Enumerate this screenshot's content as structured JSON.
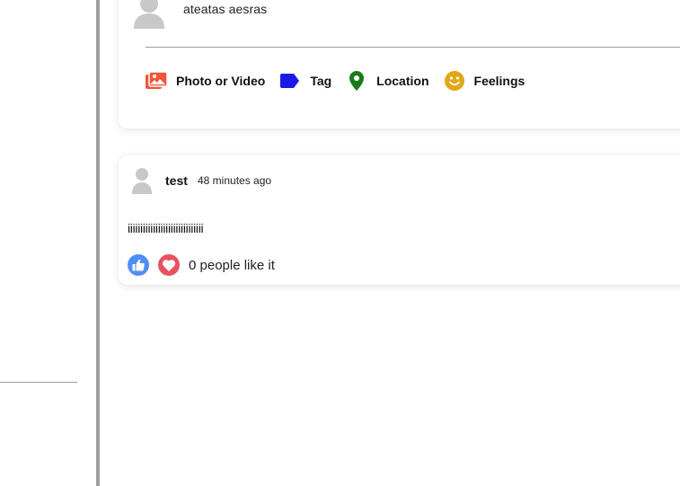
{
  "composer": {
    "user_name": "ateatas aesras",
    "actions": [
      {
        "label": "Photo or Video",
        "icon": "photo-video-icon",
        "color": "#f0563a"
      },
      {
        "label": "Tag",
        "icon": "tag-icon",
        "color": "#1a1ae6"
      },
      {
        "label": "Location",
        "icon": "location-pin-icon",
        "color": "#1a7a1a"
      },
      {
        "label": "Feelings",
        "icon": "smiley-icon",
        "color": "#e0a818"
      }
    ]
  },
  "post": {
    "author": "test",
    "time": "48 minutes ago",
    "body": "iiiiiiiiiiiiiiiiiiiiiiiiiiiiii",
    "likes_text": "0 people like it",
    "like_color": "#4f8ef7",
    "love_color": "#e8515f"
  }
}
